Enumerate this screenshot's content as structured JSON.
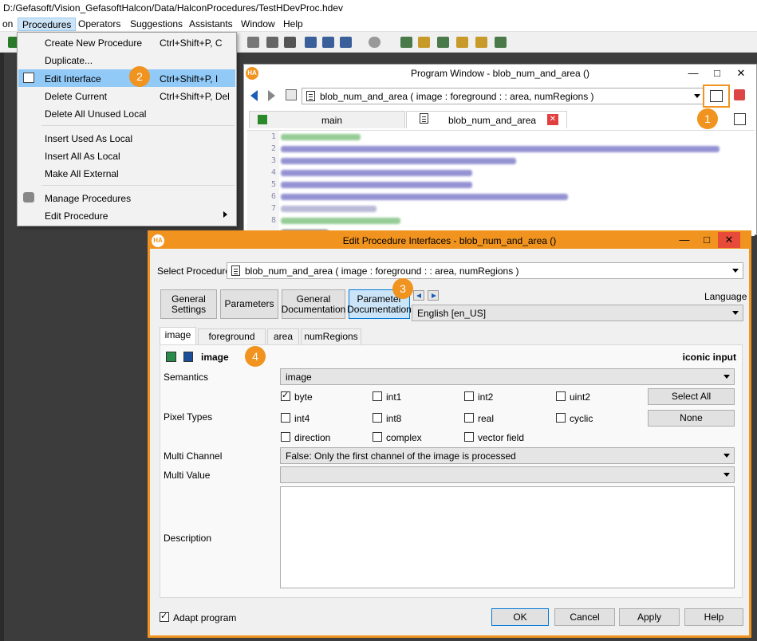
{
  "app": {
    "path_title": "D:/Gefasoft/Vision_GefasoftHalcon/Data/HalconProcedures/TestHDevProc.hdev"
  },
  "menubar": {
    "items": [
      "on",
      "Procedures",
      "Operators",
      "Suggestions",
      "Assistants",
      "Window",
      "Help"
    ]
  },
  "dropdown": {
    "items": [
      {
        "label": "Create New Procedure",
        "shortcut": "Ctrl+Shift+P, C"
      },
      {
        "label": "Duplicate...",
        "shortcut": ""
      },
      {
        "label": "Edit Interface",
        "shortcut": "Ctrl+Shift+P, I"
      },
      {
        "label": "Delete Current",
        "shortcut": "Ctrl+Shift+P, Del"
      },
      {
        "label": "Delete All Unused Local",
        "shortcut": ""
      },
      {
        "label": "Insert Used As Local",
        "shortcut": ""
      },
      {
        "label": "Insert All As Local",
        "shortcut": ""
      },
      {
        "label": "Make All External",
        "shortcut": ""
      },
      {
        "label": "Manage Procedures",
        "shortcut": ""
      },
      {
        "label": "Edit Procedure",
        "shortcut": ""
      }
    ]
  },
  "badges": [
    "1",
    "2",
    "3",
    "4"
  ],
  "program_window": {
    "title": "Program Window - blob_num_and_area ()",
    "logo": "HA",
    "procedure_signature": "blob_num_and_area ( image : foreground : : area, numRegions )",
    "tabs": [
      "main",
      "blob_num_and_area"
    ],
    "line_numbers": [
      "1",
      "2",
      "3",
      "4",
      "5",
      "6",
      "7",
      "8"
    ]
  },
  "dialog": {
    "title": "Edit Procedure Interfaces - blob_num_and_area ()",
    "logo": "HA",
    "select_procedure_label": "Select Procedure",
    "select_procedure_value": "blob_num_and_area ( image : foreground : : area, numRegions )",
    "category_buttons": [
      {
        "line1": "General",
        "line2": "Settings"
      },
      {
        "line1": "Parameters",
        "line2": ""
      },
      {
        "line1": "General",
        "line2": "Documentation"
      },
      {
        "line1": "Parameter",
        "line2": "Documentation"
      }
    ],
    "language_label": "Language",
    "language_value": "English [en_US]",
    "param_tabs": [
      "image",
      "foreground",
      "area",
      "numRegions"
    ],
    "param_name": "image",
    "param_kind": "iconic input",
    "semantics_label": "Semantics",
    "semantics_value": "image",
    "pixel_types_label": "Pixel Types",
    "pixel_types": [
      {
        "label": "byte",
        "checked": true
      },
      {
        "label": "int1",
        "checked": false
      },
      {
        "label": "int2",
        "checked": false
      },
      {
        "label": "uint2",
        "checked": false
      },
      {
        "label": "int4",
        "checked": false
      },
      {
        "label": "int8",
        "checked": false
      },
      {
        "label": "real",
        "checked": false
      },
      {
        "label": "cyclic",
        "checked": false
      },
      {
        "label": "direction",
        "checked": false
      },
      {
        "label": "complex",
        "checked": false
      },
      {
        "label": "vector field",
        "checked": false
      }
    ],
    "select_all_label": "Select All",
    "none_label": "None",
    "multi_channel_label": "Multi Channel",
    "multi_channel_value": "False: Only the first channel of the image is processed",
    "multi_value_label": "Multi Value",
    "multi_value_value": "",
    "description_label": "Description",
    "adapt_program_label": "Adapt program",
    "adapt_program_checked": true,
    "buttons": {
      "ok": "OK",
      "cancel": "Cancel",
      "apply": "Apply",
      "help": "Help"
    }
  },
  "colors": {
    "accent_orange": "#f0931f",
    "menu_highlight": "#91c9f7",
    "title_blue": "#cce4f7"
  }
}
